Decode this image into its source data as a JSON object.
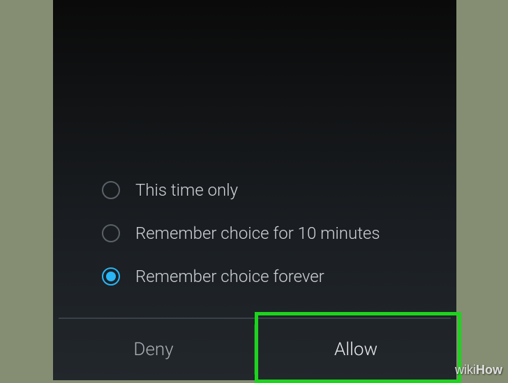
{
  "dialog": {
    "options": [
      {
        "label": "This time only",
        "selected": false
      },
      {
        "label": "Remember choice for 10 minutes",
        "selected": false
      },
      {
        "label": "Remember choice forever",
        "selected": true
      }
    ],
    "buttons": {
      "deny": "Deny",
      "allow": "Allow"
    }
  },
  "watermark": {
    "part1": "wiki",
    "part2": "How"
  }
}
